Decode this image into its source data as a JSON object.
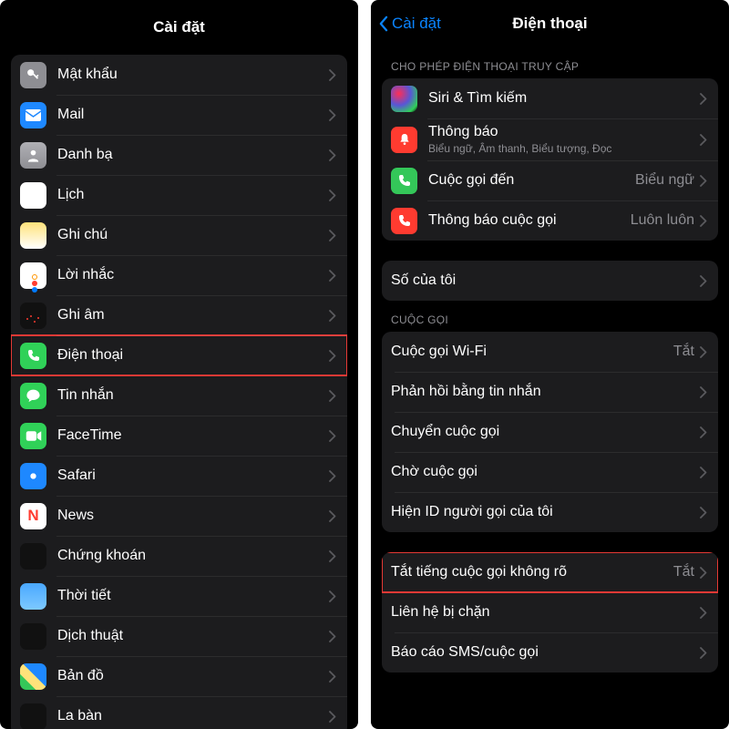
{
  "left": {
    "title": "Cài đặt",
    "rows": [
      {
        "icon": "key-icon",
        "iconClass": "ic-gray",
        "label": "Mật khẩu"
      },
      {
        "icon": "mail-icon",
        "iconClass": "ic-blue",
        "label": "Mail"
      },
      {
        "icon": "contacts-icon",
        "iconClass": "ic-contacts",
        "label": "Danh bạ"
      },
      {
        "icon": "calendar-icon",
        "iconClass": "ic-calendar",
        "label": "Lịch"
      },
      {
        "icon": "notes-icon",
        "iconClass": "ic-notes",
        "label": "Ghi chú"
      },
      {
        "icon": "reminders-icon",
        "iconClass": "ic-reminders",
        "label": "Lời nhắc"
      },
      {
        "icon": "voice-memos-icon",
        "iconClass": "ic-voice",
        "label": "Ghi âm"
      },
      {
        "icon": "phone-icon",
        "iconClass": "ic-phone",
        "label": "Điện thoại",
        "highlight": true
      },
      {
        "icon": "messages-icon",
        "iconClass": "ic-messages",
        "label": "Tin nhắn"
      },
      {
        "icon": "facetime-icon",
        "iconClass": "ic-facetime",
        "label": "FaceTime"
      },
      {
        "icon": "safari-icon",
        "iconClass": "ic-safari",
        "label": "Safari"
      },
      {
        "icon": "news-icon",
        "iconClass": "ic-news",
        "label": "News",
        "iconText": "N"
      },
      {
        "icon": "stocks-icon",
        "iconClass": "ic-stocks",
        "label": "Chứng khoán"
      },
      {
        "icon": "weather-icon",
        "iconClass": "ic-weather",
        "label": "Thời tiết"
      },
      {
        "icon": "translate-icon",
        "iconClass": "ic-translate",
        "label": "Dịch thuật"
      },
      {
        "icon": "maps-icon",
        "iconClass": "ic-maps",
        "label": "Bản đồ"
      },
      {
        "icon": "compass-icon",
        "iconClass": "ic-compass",
        "label": "La bàn"
      }
    ]
  },
  "right": {
    "back": "Cài đặt",
    "title": "Điện thoại",
    "section_access": "CHO PHÉP ĐIỆN THOẠI TRUY CẬP",
    "rows_access": [
      {
        "icon": "siri-icon",
        "iconClass": "ric-siri",
        "label": "Siri & Tìm kiếm"
      },
      {
        "icon": "bell-icon",
        "iconClass": "ric-notif",
        "label": "Thông báo",
        "sub": "Biểu ngữ, Âm thanh, Biểu tượng, Đọc"
      },
      {
        "icon": "incoming-call-icon",
        "iconClass": "ric-incoming",
        "label": "Cuộc gọi đến",
        "value": "Biểu ngữ"
      },
      {
        "icon": "announce-call-icon",
        "iconClass": "ric-announce",
        "label": "Thông báo cuộc gọi",
        "value": "Luôn luôn"
      }
    ],
    "mynumber": "Số của tôi",
    "section_calls": "CUỘC GỌI",
    "rows_calls": [
      {
        "label": "Cuộc gọi Wi-Fi",
        "value": "Tắt"
      },
      {
        "label": "Phản hồi bằng tin nhắn"
      },
      {
        "label": "Chuyển cuộc gọi"
      },
      {
        "label": "Chờ cuộc gọi"
      },
      {
        "label": "Hiện ID người gọi của tôi"
      }
    ],
    "rows_bottom": [
      {
        "label": "Tắt tiếng cuộc gọi không rõ",
        "value": "Tắt",
        "highlight": true
      },
      {
        "label": "Liên hệ bị chặn"
      },
      {
        "label": "Báo cáo SMS/cuộc gọi"
      }
    ]
  }
}
